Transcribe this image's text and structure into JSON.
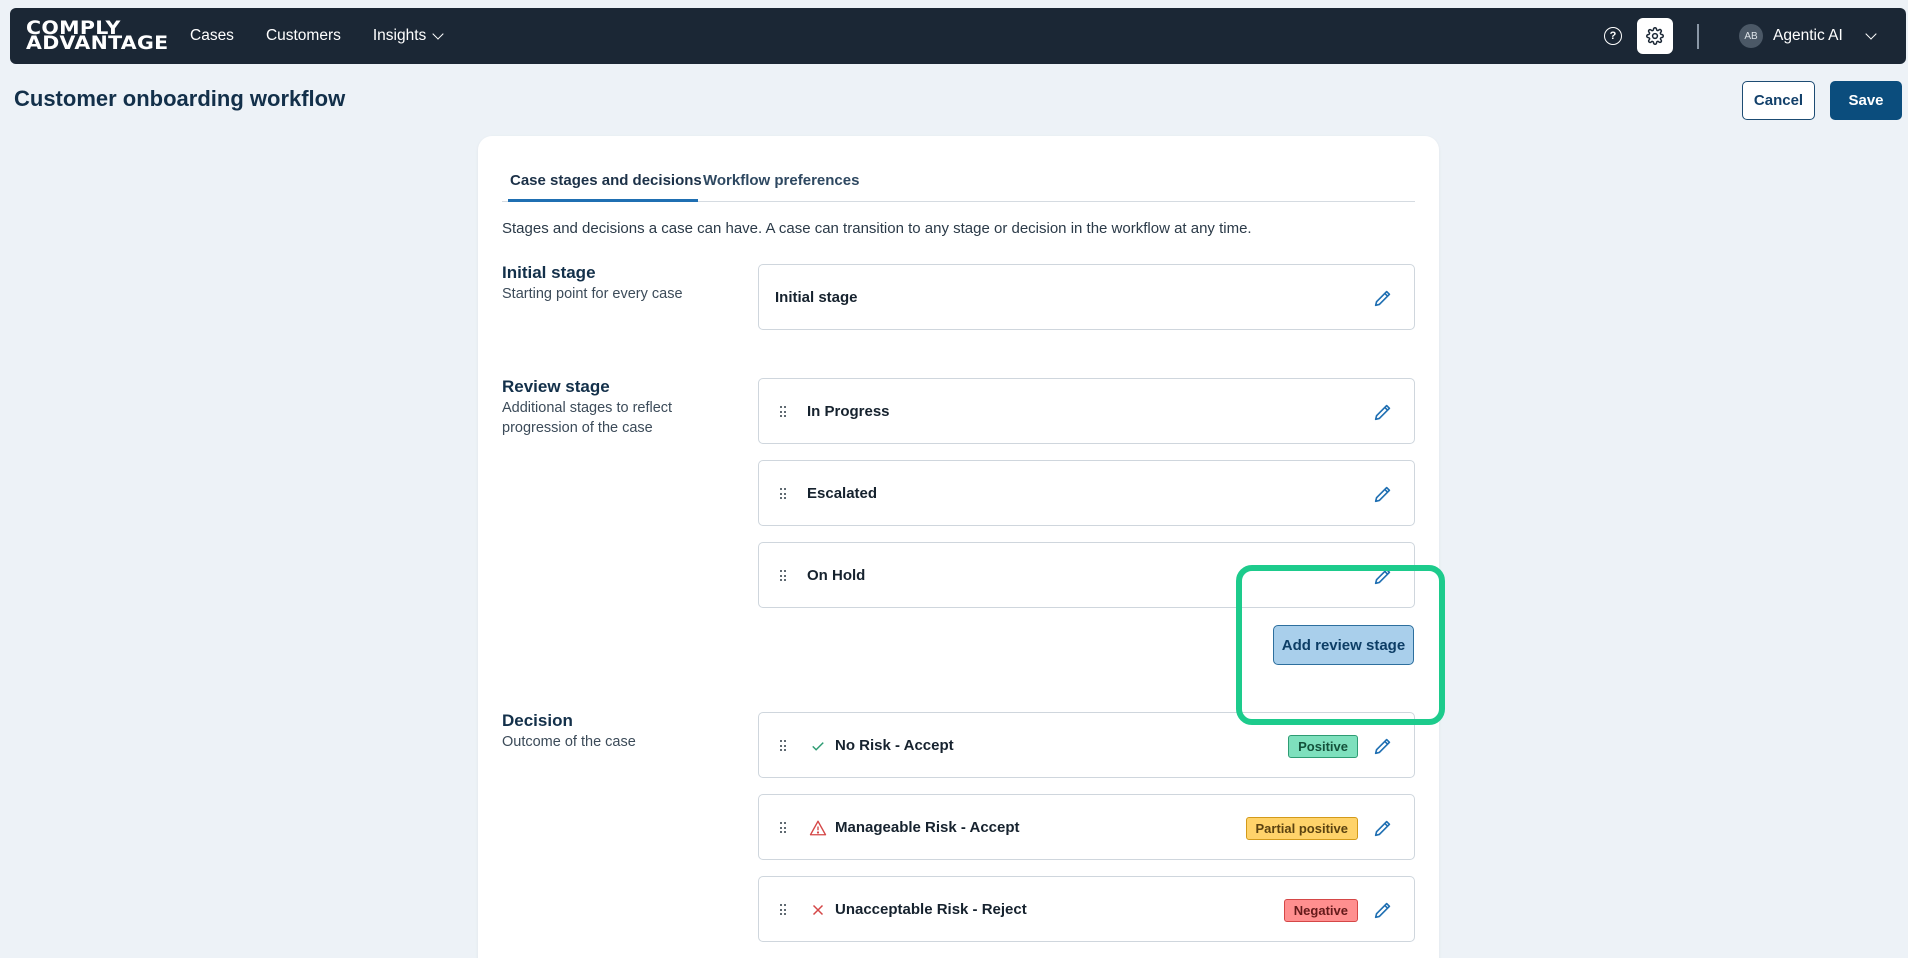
{
  "nav": {
    "logo_line1": "COMPLY",
    "logo_line2": "ADVANTAGE",
    "items": [
      {
        "label": "Cases"
      },
      {
        "label": "Customers"
      },
      {
        "label": "Insights",
        "has_dropdown": true
      }
    ],
    "help_icon": "?",
    "user_initials": "AB",
    "user_name": "Agentic AI"
  },
  "page": {
    "title": "Customer onboarding workflow",
    "cancel_label": "Cancel",
    "save_label": "Save"
  },
  "tabs": [
    {
      "label": "Case stages and decisions",
      "active": true
    },
    {
      "label": "Workflow preferences",
      "active": false
    }
  ],
  "intro": "Stages and decisions a case can have. A case can transition to any stage or decision in the workflow at any time.",
  "initial_stage": {
    "title": "Initial stage",
    "subtitle": "Starting point for every case",
    "items": [
      {
        "label": "Initial stage"
      }
    ]
  },
  "review_stage": {
    "title": "Review stage",
    "subtitle": "Additional stages to reflect progression of the case",
    "items": [
      {
        "label": "In Progress"
      },
      {
        "label": "Escalated"
      },
      {
        "label": "On Hold"
      }
    ],
    "add_label": "Add review stage"
  },
  "decision": {
    "title": "Decision",
    "subtitle": "Outcome of the case",
    "items": [
      {
        "label": "No Risk - Accept",
        "badge": "Positive",
        "icon": "check-icon"
      },
      {
        "label": "Manageable Risk - Accept",
        "badge": "Partial positive",
        "icon": "warning-icon"
      },
      {
        "label": "Unacceptable Risk - Reject",
        "badge": "Negative",
        "icon": "x-icon"
      }
    ]
  },
  "colors": {
    "topbar": "#1b2735",
    "primary": "#0b4d7d",
    "highlight": "#1dcb8c",
    "positive": "#7ee0bd",
    "partial": "#ffd36a",
    "negative": "#ff8f8f"
  }
}
